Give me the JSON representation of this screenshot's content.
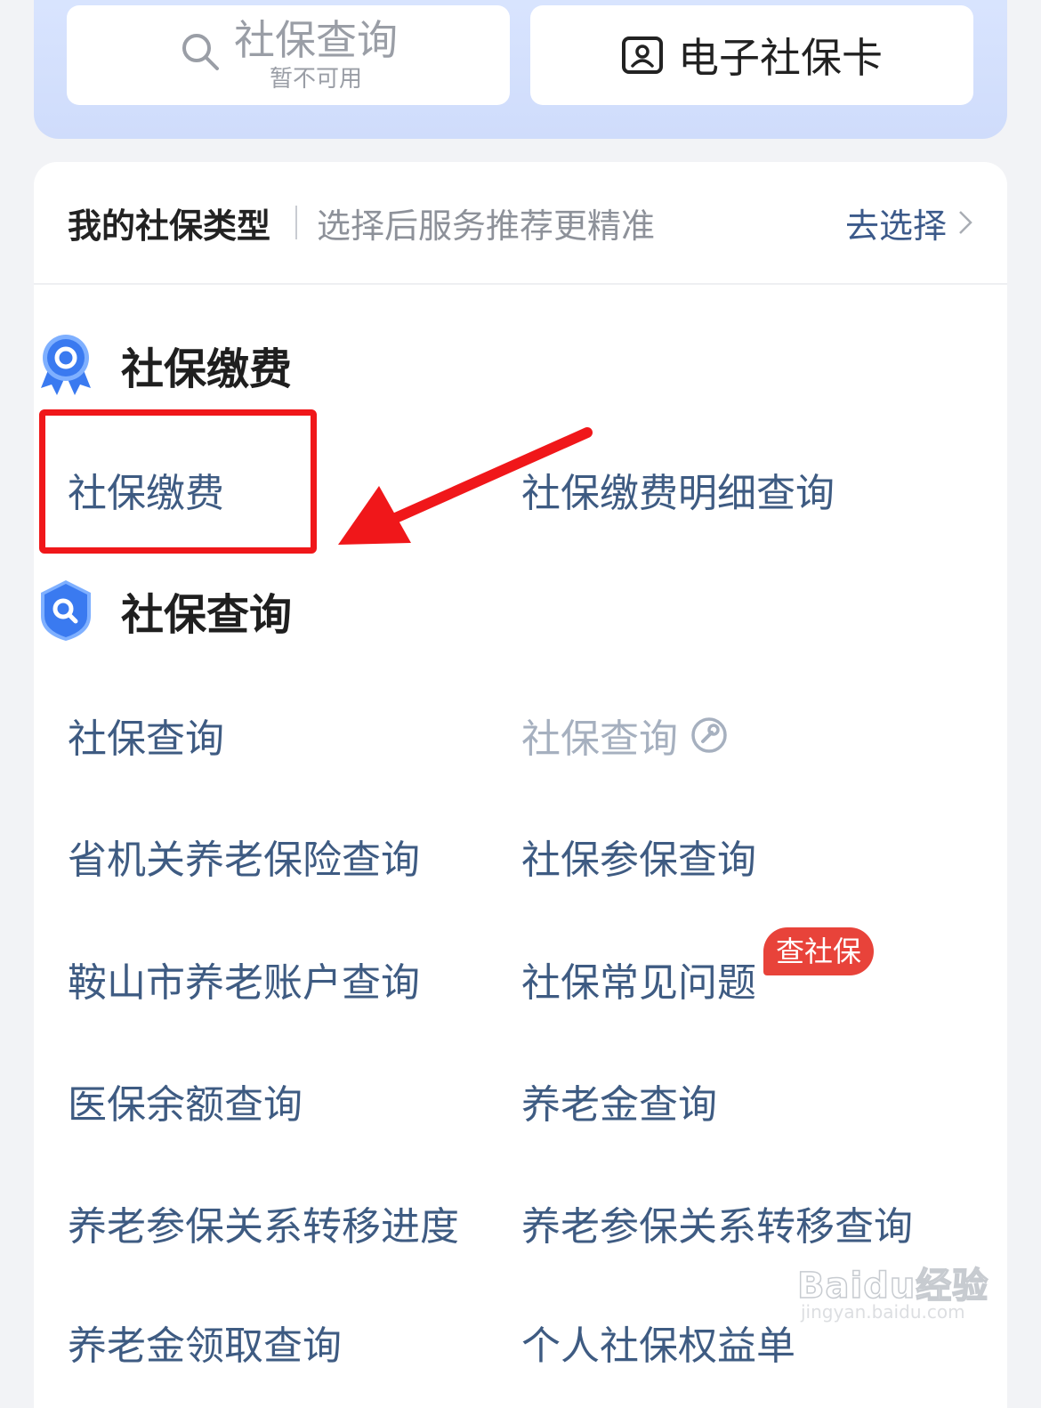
{
  "top_buttons": {
    "query": {
      "title": "社保查询",
      "subtitle": "暂不可用",
      "icon": "search-icon"
    },
    "card": {
      "title": "电子社保卡",
      "icon": "id-card-icon"
    }
  },
  "insurance_type": {
    "title": "我的社保类型",
    "hint": "选择后服务推荐更精准",
    "action": "去选择"
  },
  "sections": {
    "payment": {
      "title": "社保缴费",
      "icon": "medal-icon",
      "items": [
        "社保缴费",
        "社保缴费明细查询"
      ]
    },
    "query": {
      "title": "社保查询",
      "icon": "shield-search-icon",
      "items": [
        "社保查询",
        "社保查询",
        "省机关养老保险查询",
        "社保参保查询",
        "鞍山市养老账户查询",
        "社保常见问题",
        "医保余额查询",
        "养老金查询",
        "养老参保关系转移进度",
        "养老参保关系转移查询",
        "养老金领取查询",
        "个人社保权益单"
      ],
      "badge": "查社保"
    }
  },
  "watermark": {
    "brand": "Baidu经验",
    "url": "jingyan.baidu.com"
  },
  "colors": {
    "link": "#3e5b82",
    "disabled": "#a6b0bf",
    "badge": "#e8433a",
    "annotation": "#f0171a",
    "accent_blue": "#3a7af0"
  }
}
